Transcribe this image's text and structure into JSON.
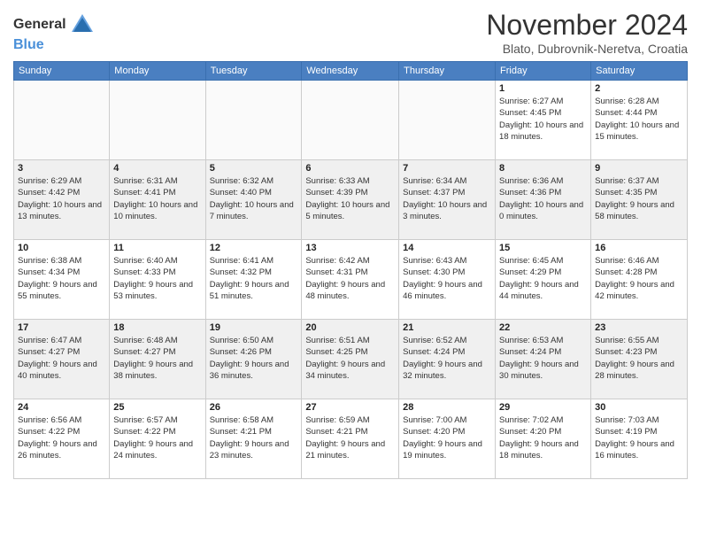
{
  "logo": {
    "general": "General",
    "blue": "Blue"
  },
  "header": {
    "month": "November 2024",
    "location": "Blato, Dubrovnik-Neretva, Croatia"
  },
  "weekdays": [
    "Sunday",
    "Monday",
    "Tuesday",
    "Wednesday",
    "Thursday",
    "Friday",
    "Saturday"
  ],
  "weeks": [
    [
      {
        "day": "",
        "info": ""
      },
      {
        "day": "",
        "info": ""
      },
      {
        "day": "",
        "info": ""
      },
      {
        "day": "",
        "info": ""
      },
      {
        "day": "",
        "info": ""
      },
      {
        "day": "1",
        "info": "Sunrise: 6:27 AM\nSunset: 4:45 PM\nDaylight: 10 hours and 18 minutes."
      },
      {
        "day": "2",
        "info": "Sunrise: 6:28 AM\nSunset: 4:44 PM\nDaylight: 10 hours and 15 minutes."
      }
    ],
    [
      {
        "day": "3",
        "info": "Sunrise: 6:29 AM\nSunset: 4:42 PM\nDaylight: 10 hours and 13 minutes."
      },
      {
        "day": "4",
        "info": "Sunrise: 6:31 AM\nSunset: 4:41 PM\nDaylight: 10 hours and 10 minutes."
      },
      {
        "day": "5",
        "info": "Sunrise: 6:32 AM\nSunset: 4:40 PM\nDaylight: 10 hours and 7 minutes."
      },
      {
        "day": "6",
        "info": "Sunrise: 6:33 AM\nSunset: 4:39 PM\nDaylight: 10 hours and 5 minutes."
      },
      {
        "day": "7",
        "info": "Sunrise: 6:34 AM\nSunset: 4:37 PM\nDaylight: 10 hours and 3 minutes."
      },
      {
        "day": "8",
        "info": "Sunrise: 6:36 AM\nSunset: 4:36 PM\nDaylight: 10 hours and 0 minutes."
      },
      {
        "day": "9",
        "info": "Sunrise: 6:37 AM\nSunset: 4:35 PM\nDaylight: 9 hours and 58 minutes."
      }
    ],
    [
      {
        "day": "10",
        "info": "Sunrise: 6:38 AM\nSunset: 4:34 PM\nDaylight: 9 hours and 55 minutes."
      },
      {
        "day": "11",
        "info": "Sunrise: 6:40 AM\nSunset: 4:33 PM\nDaylight: 9 hours and 53 minutes."
      },
      {
        "day": "12",
        "info": "Sunrise: 6:41 AM\nSunset: 4:32 PM\nDaylight: 9 hours and 51 minutes."
      },
      {
        "day": "13",
        "info": "Sunrise: 6:42 AM\nSunset: 4:31 PM\nDaylight: 9 hours and 48 minutes."
      },
      {
        "day": "14",
        "info": "Sunrise: 6:43 AM\nSunset: 4:30 PM\nDaylight: 9 hours and 46 minutes."
      },
      {
        "day": "15",
        "info": "Sunrise: 6:45 AM\nSunset: 4:29 PM\nDaylight: 9 hours and 44 minutes."
      },
      {
        "day": "16",
        "info": "Sunrise: 6:46 AM\nSunset: 4:28 PM\nDaylight: 9 hours and 42 minutes."
      }
    ],
    [
      {
        "day": "17",
        "info": "Sunrise: 6:47 AM\nSunset: 4:27 PM\nDaylight: 9 hours and 40 minutes."
      },
      {
        "day": "18",
        "info": "Sunrise: 6:48 AM\nSunset: 4:27 PM\nDaylight: 9 hours and 38 minutes."
      },
      {
        "day": "19",
        "info": "Sunrise: 6:50 AM\nSunset: 4:26 PM\nDaylight: 9 hours and 36 minutes."
      },
      {
        "day": "20",
        "info": "Sunrise: 6:51 AM\nSunset: 4:25 PM\nDaylight: 9 hours and 34 minutes."
      },
      {
        "day": "21",
        "info": "Sunrise: 6:52 AM\nSunset: 4:24 PM\nDaylight: 9 hours and 32 minutes."
      },
      {
        "day": "22",
        "info": "Sunrise: 6:53 AM\nSunset: 4:24 PM\nDaylight: 9 hours and 30 minutes."
      },
      {
        "day": "23",
        "info": "Sunrise: 6:55 AM\nSunset: 4:23 PM\nDaylight: 9 hours and 28 minutes."
      }
    ],
    [
      {
        "day": "24",
        "info": "Sunrise: 6:56 AM\nSunset: 4:22 PM\nDaylight: 9 hours and 26 minutes."
      },
      {
        "day": "25",
        "info": "Sunrise: 6:57 AM\nSunset: 4:22 PM\nDaylight: 9 hours and 24 minutes."
      },
      {
        "day": "26",
        "info": "Sunrise: 6:58 AM\nSunset: 4:21 PM\nDaylight: 9 hours and 23 minutes."
      },
      {
        "day": "27",
        "info": "Sunrise: 6:59 AM\nSunset: 4:21 PM\nDaylight: 9 hours and 21 minutes."
      },
      {
        "day": "28",
        "info": "Sunrise: 7:00 AM\nSunset: 4:20 PM\nDaylight: 9 hours and 19 minutes."
      },
      {
        "day": "29",
        "info": "Sunrise: 7:02 AM\nSunset: 4:20 PM\nDaylight: 9 hours and 18 minutes."
      },
      {
        "day": "30",
        "info": "Sunrise: 7:03 AM\nSunset: 4:19 PM\nDaylight: 9 hours and 16 minutes."
      }
    ]
  ]
}
